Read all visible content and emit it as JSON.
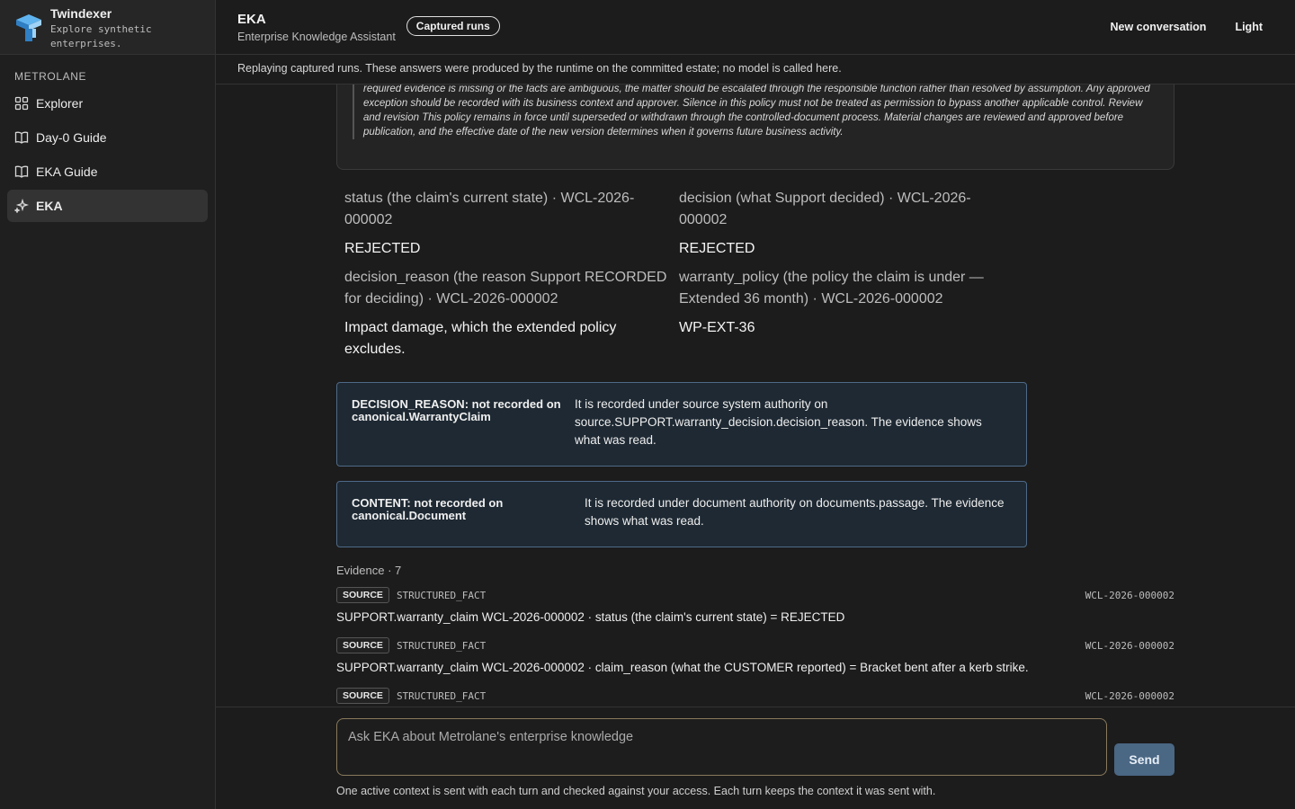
{
  "sidebar": {
    "brand_name": "Twindexer",
    "brand_tagline_line1": "Explore synthetic",
    "brand_tagline_line2": "enterprises.",
    "section_label": "METROLANE",
    "items": [
      {
        "label": "Explorer",
        "icon": "grid-icon"
      },
      {
        "label": "Day-0 Guide",
        "icon": "book-icon"
      },
      {
        "label": "EKA Guide",
        "icon": "book-icon"
      },
      {
        "label": "EKA",
        "icon": "sparkle-icon",
        "active": true
      }
    ]
  },
  "header": {
    "title": "EKA",
    "subtitle": "Enterprise Knowledge Assistant",
    "badge": "Captured runs",
    "new_conversation": "New conversation",
    "theme_toggle": "Light"
  },
  "notice": "Replaying captured runs. These answers were produced by the runtime on the committed estate; no model is called here.",
  "policy_excerpt": "required evidence is missing or the facts are ambiguous, the matter should be escalated through the responsible function rather than resolved by assumption. Any approved exception should be recorded with its business context and approver. Silence in this policy must not be treated as permission to bypass another applicable control. Review and revision This policy remains in force until superseded or withdrawn through the controlled-document process. Material changes are reviewed and approved before publication, and the effective date of the new version determines when it governs future business activity.",
  "facts": [
    {
      "label": "status (the claim's current state) · WCL-2026-000002",
      "value": "REJECTED"
    },
    {
      "label": "decision (what Support decided) · WCL-2026-000002",
      "value": "REJECTED"
    },
    {
      "label": "decision_reason (the reason Support RECORDED for deciding) · WCL-2026-000002",
      "value": "Impact damage, which the extended policy excludes."
    },
    {
      "label": "warranty_policy (the policy the claim is under — Extended 36 month) · WCL-2026-000002",
      "value": "WP-EXT-36"
    }
  ],
  "warnings": [
    {
      "title": "DECISION_REASON: not recorded on canonical.WarrantyClaim",
      "body": "It is recorded under source system authority on source.SUPPORT.warranty_decision.decision_reason. The evidence shows what was read."
    },
    {
      "title": "CONTENT: not recorded on canonical.Document",
      "body": "It is recorded under document authority on documents.passage. The evidence shows what was read."
    }
  ],
  "evidence": {
    "heading": "Evidence · 7",
    "items": [
      {
        "tag": "SOURCE",
        "kind": "STRUCTURED_FACT",
        "ref": "WCL-2026-000002",
        "text": "SUPPORT.warranty_claim WCL-2026-000002 · status (the claim's current state) = REJECTED"
      },
      {
        "tag": "SOURCE",
        "kind": "STRUCTURED_FACT",
        "ref": "WCL-2026-000002",
        "text": "SUPPORT.warranty_claim WCL-2026-000002 · claim_reason (what the CUSTOMER reported) = Bracket bent after a kerb strike."
      },
      {
        "tag": "SOURCE",
        "kind": "STRUCTURED_FACT",
        "ref": "WCL-2026-000002",
        "text": ""
      }
    ]
  },
  "composer": {
    "placeholder": "Ask EKA about Metrolane's enterprise knowledge",
    "send_label": "Send",
    "note": "One active context is sent with each turn and checked against your access. Each turn keeps the context it was sent with."
  }
}
